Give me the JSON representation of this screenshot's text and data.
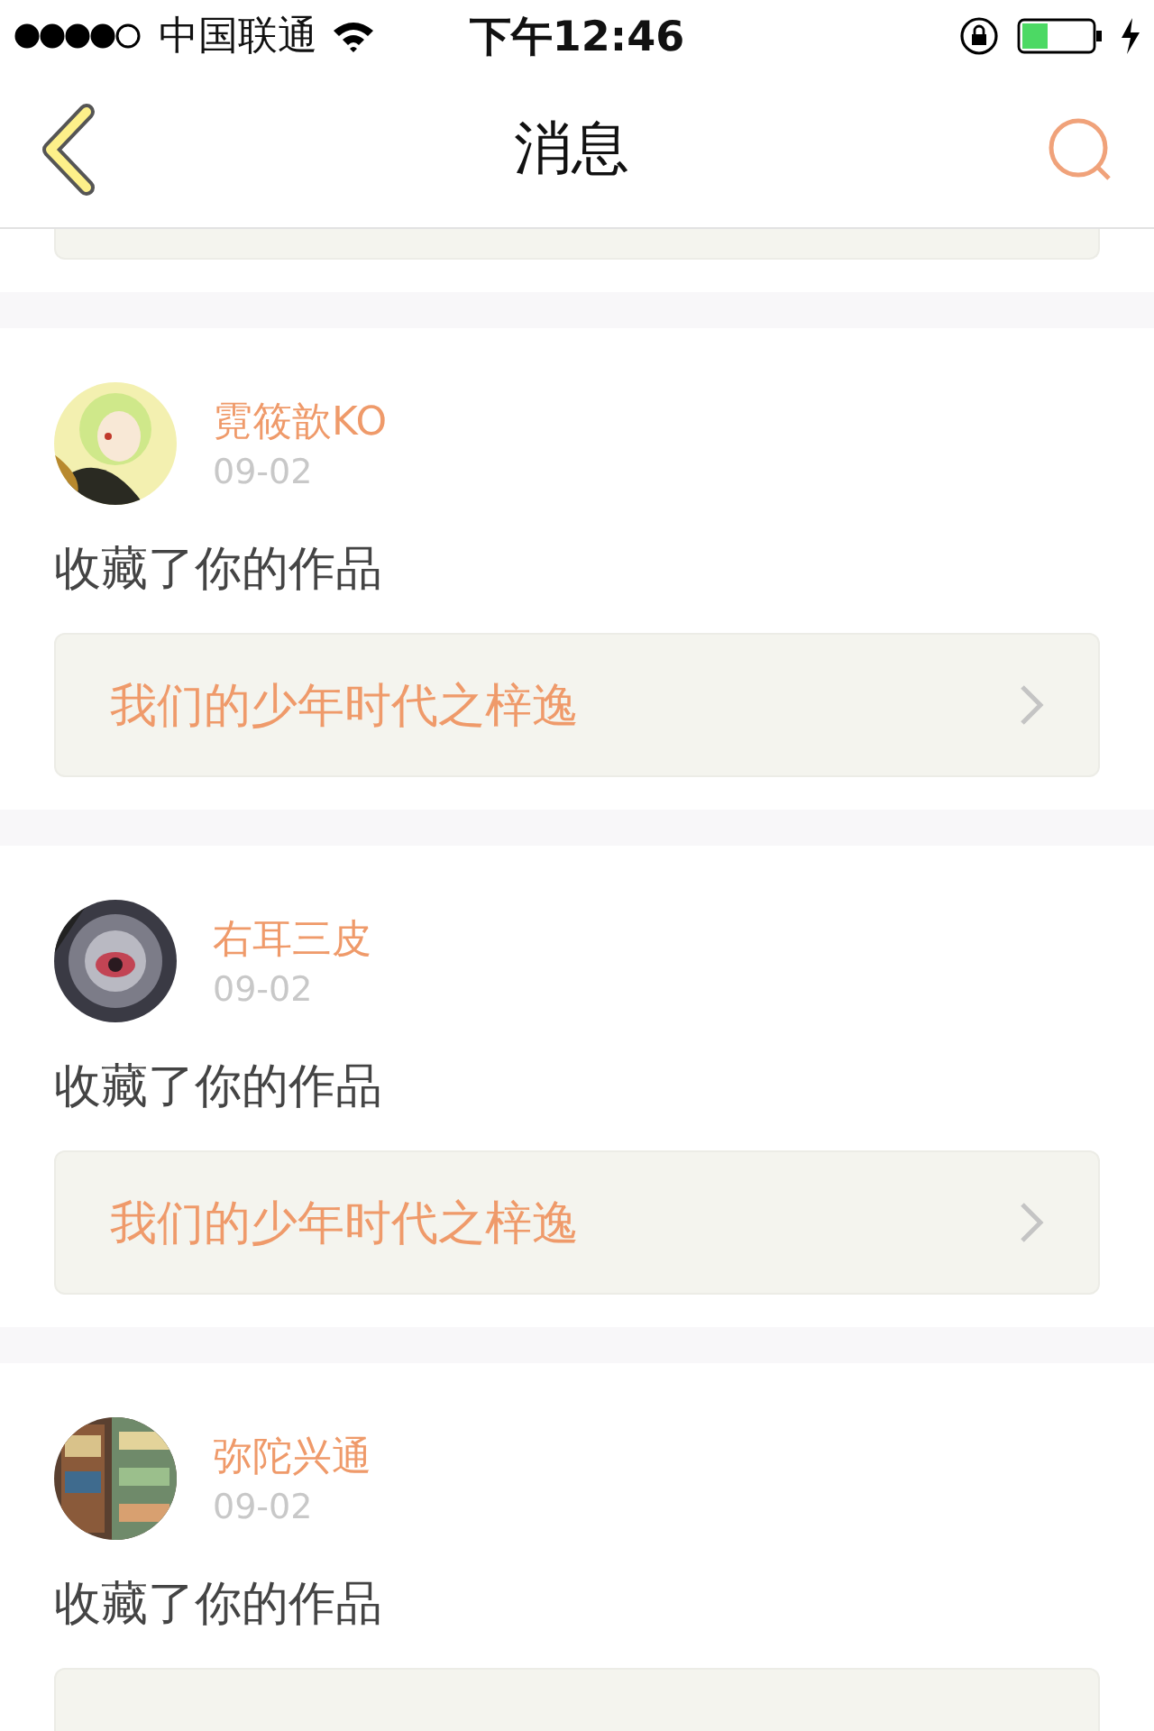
{
  "status_bar": {
    "carrier": "中国联通",
    "time": "下午12:46"
  },
  "nav": {
    "title": "消息"
  },
  "messages": [
    {
      "user": "霓筱歆KO",
      "date": "09-02",
      "action": "收藏了你的作品",
      "work": "我们的少年时代之梓逸"
    },
    {
      "user": "右耳三皮",
      "date": "09-02",
      "action": "收藏了你的作品",
      "work": "我们的少年时代之梓逸"
    },
    {
      "user": "弥陀兴通",
      "date": "09-02",
      "action": "收藏了你的作品"
    }
  ]
}
